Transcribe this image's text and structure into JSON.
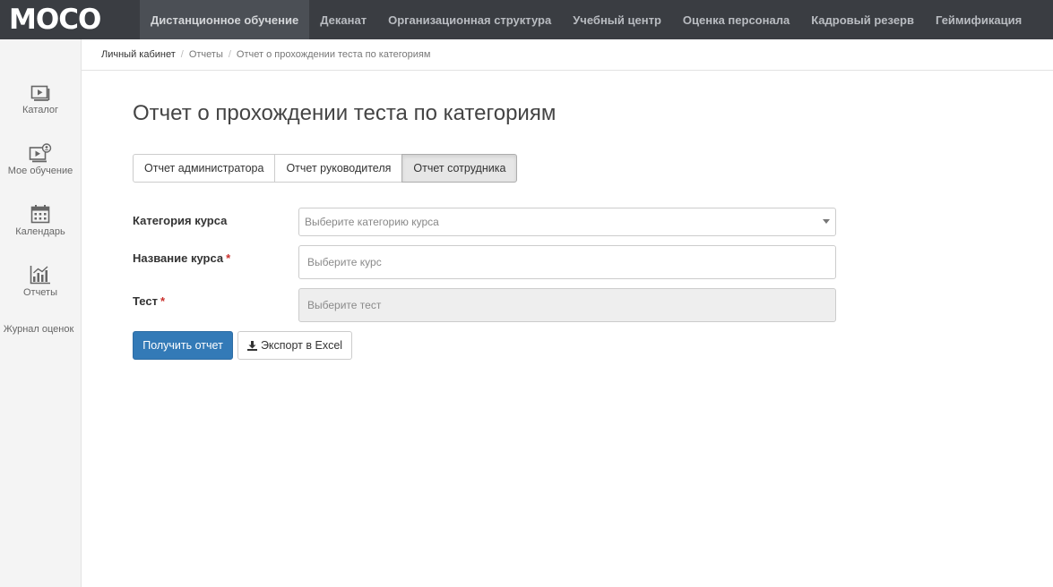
{
  "app": {
    "logo_text": "MOCO"
  },
  "topnav": {
    "items": [
      {
        "label": "Дистанционное обучение",
        "active": true
      },
      {
        "label": "Деканат"
      },
      {
        "label": "Организационная структура"
      },
      {
        "label": "Учебный центр"
      },
      {
        "label": "Оценка персонала"
      },
      {
        "label": "Кадровый резерв"
      },
      {
        "label": "Геймификация"
      }
    ]
  },
  "sidebar": {
    "items": [
      {
        "label": "Каталог",
        "icon": "catalog-icon"
      },
      {
        "label": "Мое обучение",
        "icon": "my-learning-icon"
      },
      {
        "label": "Календарь",
        "icon": "calendar-icon"
      },
      {
        "label": "Отчеты",
        "icon": "reports-icon"
      },
      {
        "label": "Журнал оценок"
      }
    ]
  },
  "breadcrumb": {
    "items": [
      "Личный кабинет",
      "Отчеты"
    ],
    "separator": "/",
    "current": "Отчет о прохождении теста по категориям"
  },
  "page": {
    "title": "Отчет о прохождении теста по категориям"
  },
  "report_tabs": [
    {
      "label": "Отчет администратора"
    },
    {
      "label": "Отчет руководителя"
    },
    {
      "label": "Отчет сотрудника",
      "active": true
    }
  ],
  "form": {
    "category": {
      "label": "Категория курса",
      "placeholder": "Выберите категорию курса",
      "value": ""
    },
    "course": {
      "label": "Название курса",
      "required_mark": "*",
      "placeholder": "Выберите курс",
      "value": ""
    },
    "test": {
      "label": "Тест",
      "required_mark": "*",
      "placeholder": "Выберите тест",
      "value": "",
      "disabled": true
    }
  },
  "actions": {
    "get_report": "Получить отчет",
    "export_excel": "Экспорт в Excel"
  },
  "colors": {
    "topbar": "#3a3d42",
    "primary": "#337ab7",
    "required": "#c9302c"
  }
}
